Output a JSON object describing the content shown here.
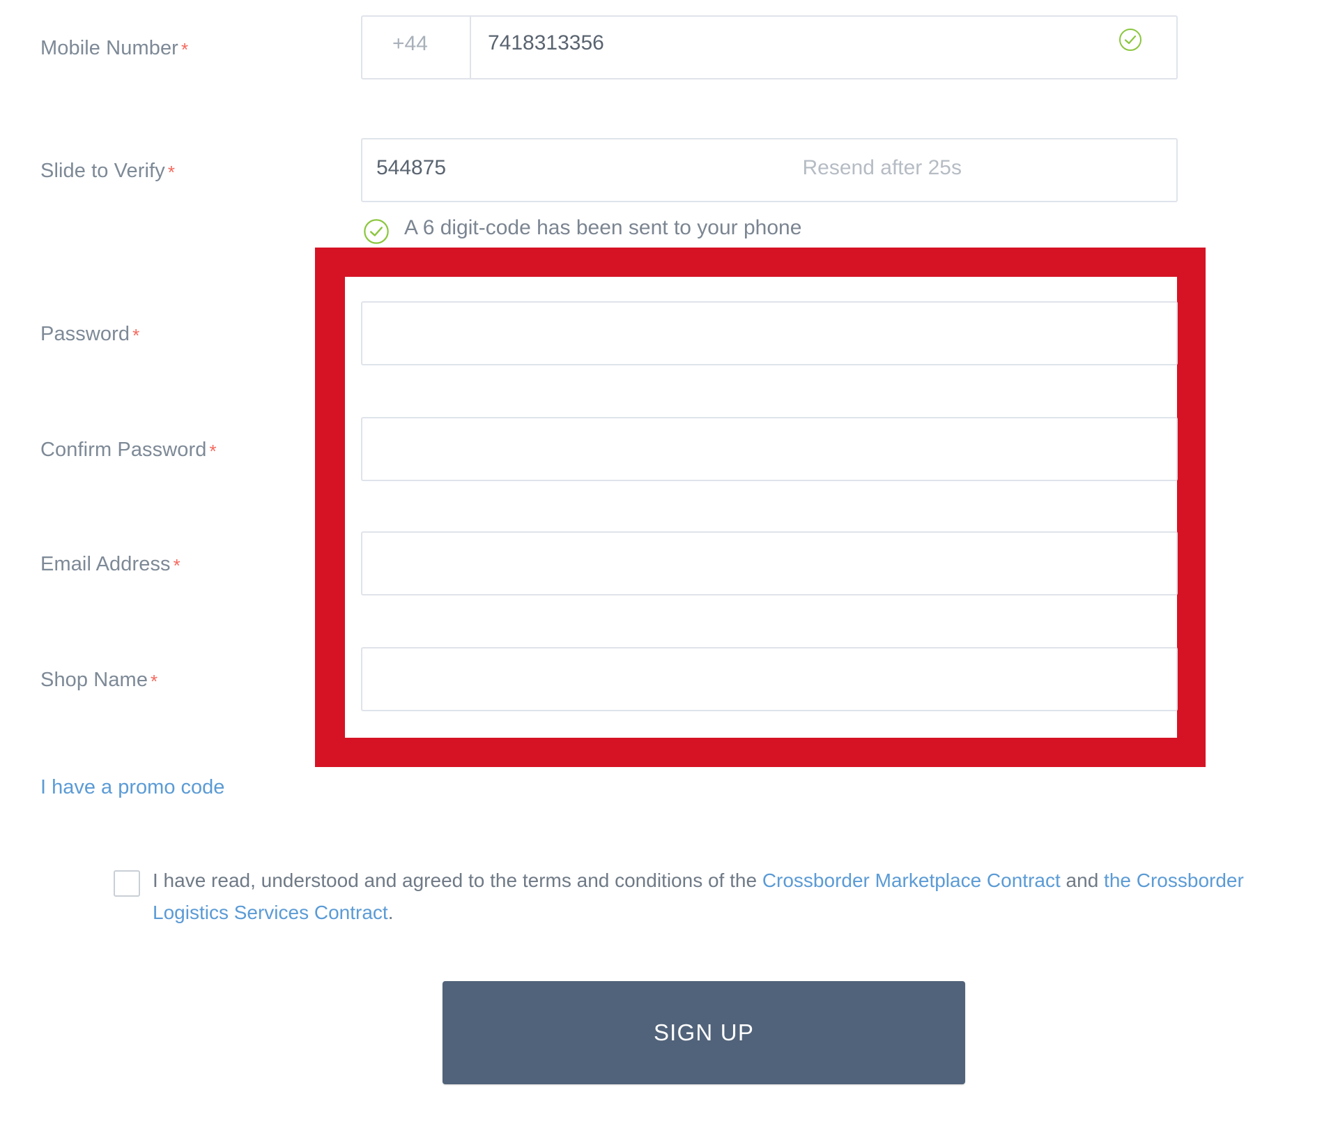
{
  "form": {
    "fields": [
      {
        "id": "mobile",
        "label": "Mobile Number",
        "required_mark": "*",
        "country_code": "+44",
        "value": "7418313356",
        "status_icon": "check-circle-icon"
      },
      {
        "id": "verify",
        "label": "Slide to Verify",
        "required_mark": "*",
        "value": "544875",
        "resend_text": "Resend after 25s",
        "hint": "A 6 digit-code has been sent to your phone",
        "hint_icon": "check-circle-icon"
      },
      {
        "id": "password",
        "label": "Password",
        "required_mark": "*",
        "value": "",
        "placeholder": ""
      },
      {
        "id": "confirm_password",
        "label": "Confirm Password",
        "required_mark": "*",
        "value": "",
        "placeholder": ""
      },
      {
        "id": "email",
        "label": "Email Address",
        "required_mark": "*",
        "value": "",
        "placeholder": ""
      },
      {
        "id": "shop_name",
        "label": "Shop Name",
        "required_mark": "*",
        "value": "",
        "placeholder": ""
      }
    ],
    "promo_link": "I have a promo code",
    "terms": {
      "text_before": "I have read, understood and agreed to the terms and conditions of the ",
      "link1": "Crossborder Marketplace Contract",
      "text_middle": " and ",
      "link2": "the Crossborder Logistics Services Contract",
      "text_after": ".",
      "checked": false
    },
    "submit_label": "SIGN UP"
  },
  "annotation": {
    "type": "highlight-rectangle",
    "color": "#d51324",
    "encloses": [
      "password",
      "confirm_password",
      "email",
      "shop_name"
    ]
  },
  "colors": {
    "accent_red": "#d51324",
    "required_asterisk": "#f4695e",
    "link_blue": "#5b9bd5",
    "button_bg": "#51637a",
    "label_gray": "#7d8996",
    "input_border": "#dfe3ea",
    "success_green": "#7ab648"
  }
}
